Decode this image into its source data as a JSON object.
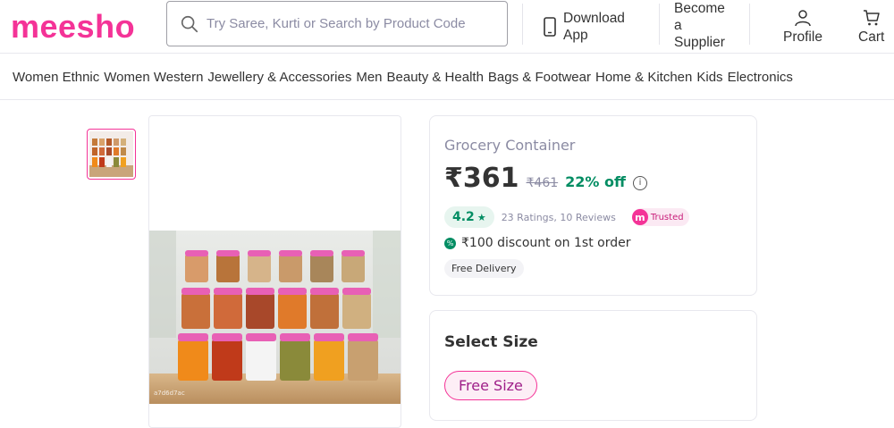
{
  "header": {
    "logo": "meesho",
    "search_placeholder": "Try Saree, Kurti or Search by Product Code",
    "download_line1": "Download",
    "download_line2": "App",
    "supplier_line1": "Become",
    "supplier_line2": "a",
    "supplier_line3": "Supplier",
    "profile": "Profile",
    "cart": "Cart"
  },
  "categories": [
    "Women Ethnic",
    "Women Western",
    "Jewellery & Accessories",
    "Men",
    "Beauty & Health",
    "Bags & Footwear",
    "Home & Kitchen",
    "Kids",
    "Electronics"
  ],
  "product": {
    "title": "Grocery Container",
    "price": "₹361",
    "mrp": "₹461",
    "discount": "22% off",
    "rating": "4.2",
    "rating_meta": "23 Ratings, 10 Reviews",
    "trusted": "Trusted",
    "offer": "₹100 discount on 1st order",
    "delivery": "Free Delivery",
    "image_code": "a7d6d7ac"
  },
  "size": {
    "title": "Select Size",
    "option": "Free Size"
  },
  "colors": {
    "brand": "#f43397",
    "green": "#038d63"
  }
}
